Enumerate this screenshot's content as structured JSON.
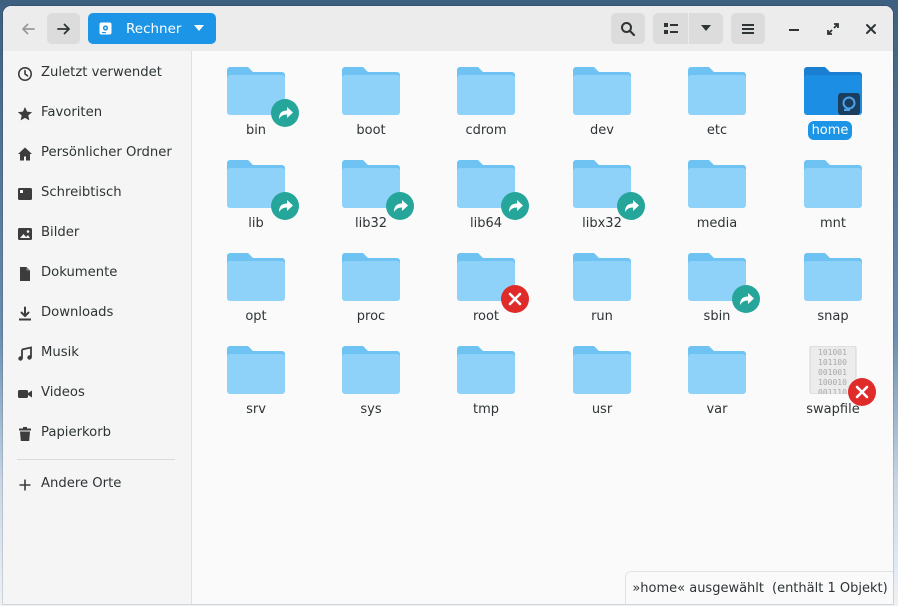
{
  "window": {
    "location_label": "Rechner"
  },
  "sidebar": {
    "items": [
      {
        "label": "Zuletzt verwendet",
        "icon": "recent-icon"
      },
      {
        "label": "Favoriten",
        "icon": "star-icon"
      },
      {
        "label": "Persönlicher Ordner",
        "icon": "home-icon"
      },
      {
        "label": "Schreibtisch",
        "icon": "desktop-icon"
      },
      {
        "label": "Bilder",
        "icon": "pictures-icon"
      },
      {
        "label": "Dokumente",
        "icon": "document-icon"
      },
      {
        "label": "Downloads",
        "icon": "download-icon"
      },
      {
        "label": "Musik",
        "icon": "music-icon"
      },
      {
        "label": "Videos",
        "icon": "video-icon"
      },
      {
        "label": "Papierkorb",
        "icon": "trash-icon"
      }
    ],
    "other_locations": "Andere Orte"
  },
  "files": [
    {
      "name": "bin",
      "type": "folder",
      "emblem": "link"
    },
    {
      "name": "boot",
      "type": "folder",
      "emblem": ""
    },
    {
      "name": "cdrom",
      "type": "folder",
      "emblem": ""
    },
    {
      "name": "dev",
      "type": "folder",
      "emblem": ""
    },
    {
      "name": "etc",
      "type": "folder",
      "emblem": ""
    },
    {
      "name": "home",
      "type": "folder-home",
      "emblem": "",
      "selected": true
    },
    {
      "name": "lib",
      "type": "folder",
      "emblem": "link"
    },
    {
      "name": "lib32",
      "type": "folder",
      "emblem": "link"
    },
    {
      "name": "lib64",
      "type": "folder",
      "emblem": "link"
    },
    {
      "name": "libx32",
      "type": "folder",
      "emblem": "link"
    },
    {
      "name": "media",
      "type": "folder",
      "emblem": ""
    },
    {
      "name": "mnt",
      "type": "folder",
      "emblem": ""
    },
    {
      "name": "opt",
      "type": "folder",
      "emblem": ""
    },
    {
      "name": "proc",
      "type": "folder",
      "emblem": ""
    },
    {
      "name": "root",
      "type": "folder",
      "emblem": "unreadable"
    },
    {
      "name": "run",
      "type": "folder",
      "emblem": ""
    },
    {
      "name": "sbin",
      "type": "folder",
      "emblem": "link"
    },
    {
      "name": "snap",
      "type": "folder",
      "emblem": ""
    },
    {
      "name": "srv",
      "type": "folder",
      "emblem": ""
    },
    {
      "name": "sys",
      "type": "folder",
      "emblem": ""
    },
    {
      "name": "tmp",
      "type": "folder",
      "emblem": ""
    },
    {
      "name": "usr",
      "type": "folder",
      "emblem": ""
    },
    {
      "name": "var",
      "type": "folder",
      "emblem": ""
    },
    {
      "name": "swapfile",
      "type": "binary",
      "emblem": "unreadable",
      "binary_text": "101001\n101100\n001001\n100010\n001110"
    }
  ],
  "status": {
    "selection": "»home« ausgewählt",
    "details": "(enthält 1 Objekt)"
  },
  "colors": {
    "accent": "#1c95e6",
    "folder": "#8ed2f9",
    "folder_tab": "#6ec3f3",
    "link_emblem": "#26a69a",
    "error_emblem": "#e02b2b"
  }
}
